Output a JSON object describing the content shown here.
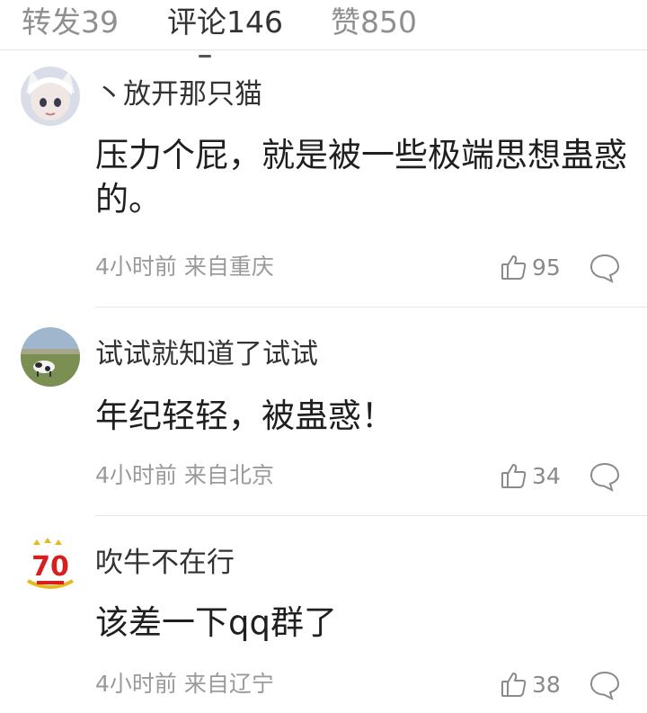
{
  "tabs": [
    {
      "label": "转发39"
    },
    {
      "label": "评论146"
    },
    {
      "label": "赞850"
    }
  ],
  "comments": [
    {
      "username": "丶放开那只猫",
      "text": "压力个屁，就是被一些极端思想蛊惑的。",
      "time": "4小时前",
      "location": "来自重庆",
      "likes": "95",
      "avatar": "cartoon-girl-avatar"
    },
    {
      "username": "试试就知道了试试",
      "text": "年纪轻轻，被蛊惑！",
      "time": "4小时前",
      "location": "来自北京",
      "likes": "34",
      "avatar": "cow-grassland-avatar"
    },
    {
      "username": "吹牛不在行",
      "text": "该差一下qq群了",
      "time": "4小时前",
      "location": "来自辽宁",
      "likes": "38",
      "avatar": "anniversary-70-logo-avatar"
    }
  ],
  "avatar3_logo_text": "70"
}
